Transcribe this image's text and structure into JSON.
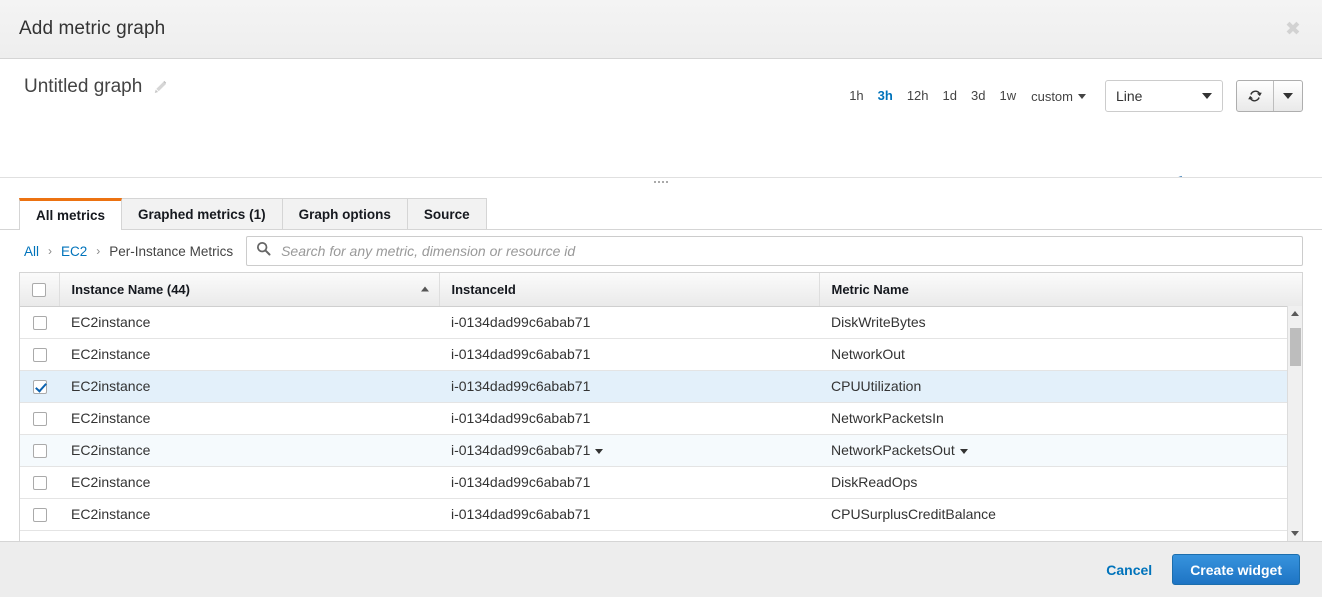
{
  "dialog": {
    "title": "Add metric graph",
    "close_icon": "close-icon"
  },
  "graph": {
    "name": "Untitled graph",
    "edit_icon": "pencil-icon",
    "ranges": [
      {
        "label": "1h",
        "active": false
      },
      {
        "label": "3h",
        "active": true
      },
      {
        "label": "12h",
        "active": false
      },
      {
        "label": "1d",
        "active": false
      },
      {
        "label": "3d",
        "active": false
      },
      {
        "label": "1w",
        "active": false
      }
    ],
    "custom_label": "custom",
    "chart_type": "Line",
    "refresh_icon": "refresh-icon",
    "refresh_caret_icon": "chevron-down-icon",
    "line_color": "#3c7eb8"
  },
  "tabs": [
    {
      "label": "All metrics",
      "active": true
    },
    {
      "label": "Graphed metrics (1)",
      "active": false
    },
    {
      "label": "Graph options",
      "active": false
    },
    {
      "label": "Source",
      "active": false
    }
  ],
  "breadcrumb": [
    {
      "label": "All",
      "link": true
    },
    {
      "label": "EC2",
      "link": true
    },
    {
      "label": "Per-Instance Metrics",
      "link": false
    }
  ],
  "search": {
    "placeholder": "Search for any metric, dimension or resource id",
    "value": "",
    "icon": "search-icon"
  },
  "table": {
    "columns": [
      {
        "label": "Instance Name  (44)",
        "sorted": "asc"
      },
      {
        "label": "InstanceId",
        "sorted": ""
      },
      {
        "label": "Metric Name",
        "sorted": ""
      }
    ],
    "rows": [
      {
        "checked": false,
        "alt": false,
        "instance_name": "EC2instance",
        "instance_id": "i-0134dad99c6abab71",
        "instance_id_caret": false,
        "metric_name": "DiskWriteBytes",
        "metric_caret": false
      },
      {
        "checked": false,
        "alt": false,
        "instance_name": "EC2instance",
        "instance_id": "i-0134dad99c6abab71",
        "instance_id_caret": false,
        "metric_name": "NetworkOut",
        "metric_caret": false
      },
      {
        "checked": true,
        "alt": false,
        "instance_name": "EC2instance",
        "instance_id": "i-0134dad99c6abab71",
        "instance_id_caret": false,
        "metric_name": "CPUUtilization",
        "metric_caret": false
      },
      {
        "checked": false,
        "alt": false,
        "instance_name": "EC2instance",
        "instance_id": "i-0134dad99c6abab71",
        "instance_id_caret": false,
        "metric_name": "NetworkPacketsIn",
        "metric_caret": false
      },
      {
        "checked": false,
        "alt": true,
        "instance_name": "EC2instance",
        "instance_id": "i-0134dad99c6abab71",
        "instance_id_caret": true,
        "metric_name": "NetworkPacketsOut",
        "metric_caret": true
      },
      {
        "checked": false,
        "alt": false,
        "instance_name": "EC2instance",
        "instance_id": "i-0134dad99c6abab71",
        "instance_id_caret": false,
        "metric_name": "DiskReadOps",
        "metric_caret": false
      },
      {
        "checked": false,
        "alt": false,
        "instance_name": "EC2instance",
        "instance_id": "i-0134dad99c6abab71",
        "instance_id_caret": false,
        "metric_name": "CPUSurplusCreditBalance",
        "metric_caret": false
      }
    ]
  },
  "footer": {
    "cancel_label": "Cancel",
    "create_label": "Create widget",
    "primary_color": "#2a7fc4"
  }
}
